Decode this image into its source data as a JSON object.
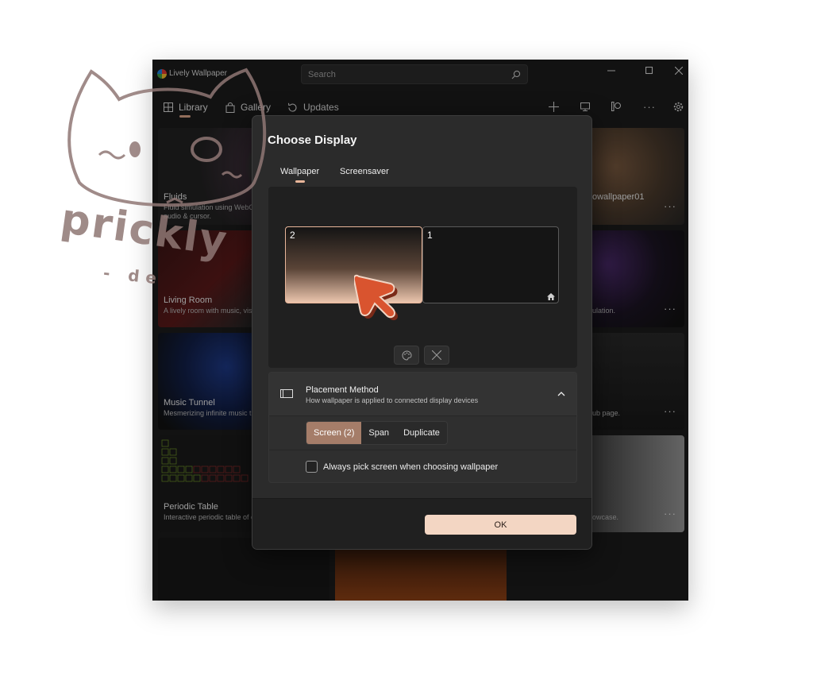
{
  "app": {
    "title": "Lively Wallpaper"
  },
  "search": {
    "placeholder": "Search"
  },
  "nav": {
    "tabs": [
      {
        "label": "Library"
      },
      {
        "label": "Gallery"
      },
      {
        "label": "Updates"
      }
    ]
  },
  "library": {
    "tiles": [
      {
        "title": "Fluids",
        "desc": "Fluid simulation using WebGL, reacts to system audio & cursor."
      },
      {
        "title": "Living Room",
        "desc": "A lively room with music, visualizer & more!"
      },
      {
        "title": "Music Tunnel",
        "desc": "Mesmerizing infinite music tunnel."
      },
      {
        "title": "Periodic Table",
        "desc": "Interactive periodic table of elements."
      }
    ],
    "right_fragments": [
      "owallpaper01",
      "ulation.",
      "ub page.",
      "owcase."
    ]
  },
  "dialog": {
    "title": "Choose Display",
    "tabs": [
      {
        "label": "Wallpaper",
        "active": true
      },
      {
        "label": "Screensaver",
        "active": false
      }
    ],
    "monitors": [
      {
        "number": "2",
        "selected": true
      },
      {
        "number": "1",
        "selected": false,
        "primary": true
      }
    ],
    "placement": {
      "title": "Placement Method",
      "description": "How wallpaper is applied to connected display devices",
      "options": [
        {
          "label": "Screen (2)",
          "active": true
        },
        {
          "label": "Span",
          "active": false
        },
        {
          "label": "Duplicate",
          "active": false
        }
      ],
      "checkbox_label": "Always pick screen when choosing wallpaper",
      "checkbox_checked": false
    },
    "ok_label": "OK"
  },
  "watermark": {
    "text": "prickly",
    "subtext": "- de"
  },
  "colors": {
    "accent": "#f3d6c3",
    "accent_dark": "#a57d69",
    "cursor": "#d9542f",
    "window_bg": "#1c1c1c",
    "dialog_bg": "#2b2b2b"
  }
}
